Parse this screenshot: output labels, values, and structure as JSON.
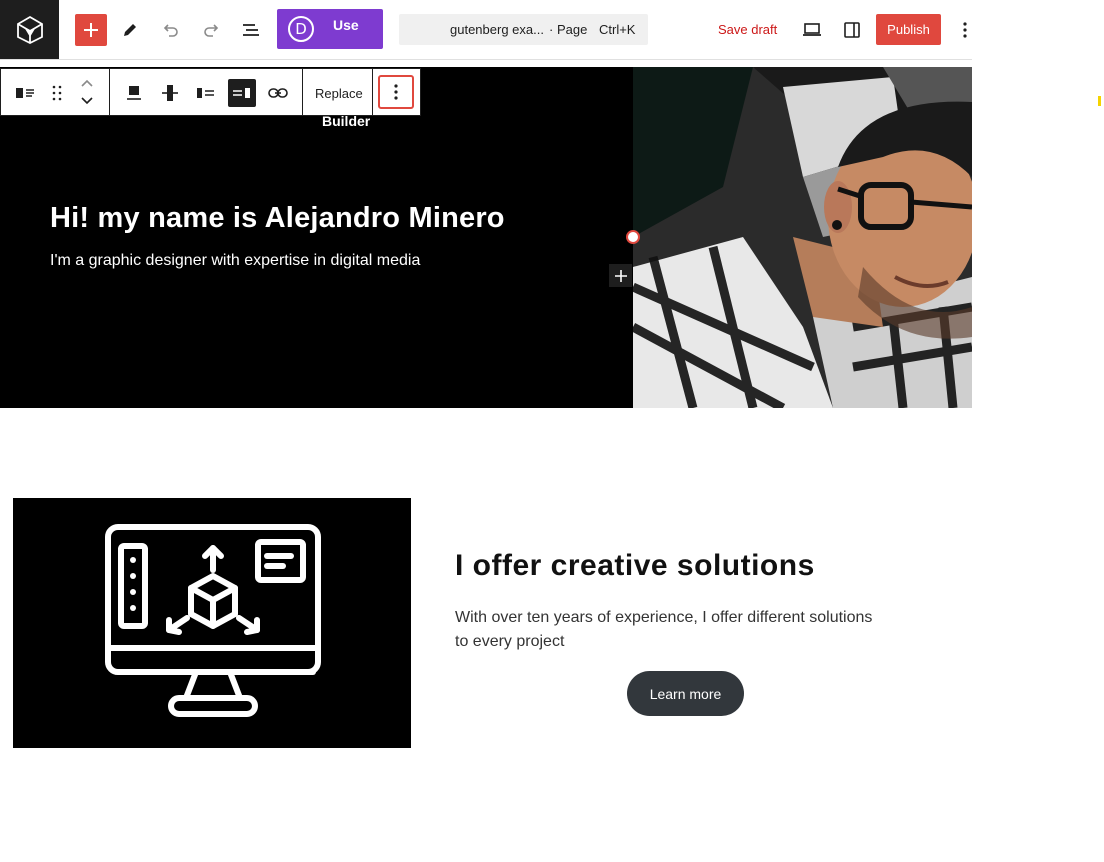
{
  "header": {
    "add_label": "+",
    "divi_letter": "D",
    "divi_label_line1": "Use",
    "divi_label_line2": "Builder",
    "command": {
      "title": "gutenberg exa...",
      "type": "· Page",
      "shortcut": "Ctrl+K"
    },
    "save_draft": "Save draft",
    "publish": "Publish"
  },
  "block_toolbar": {
    "replace_label": "Replace"
  },
  "hero": {
    "title": "Hi! my name is Alejandro Minero",
    "subtitle": "I'm a graphic designer with expertise in digital media"
  },
  "feature": {
    "title": "I offer creative solutions",
    "text": "With over ten years of experience, I offer different solutions to every project",
    "button": "Learn more"
  },
  "colors": {
    "accent_red": "#e0483e",
    "divi_purple": "#7e3bd0",
    "dark": "#1e1e1e",
    "button_dark": "#32373c"
  }
}
